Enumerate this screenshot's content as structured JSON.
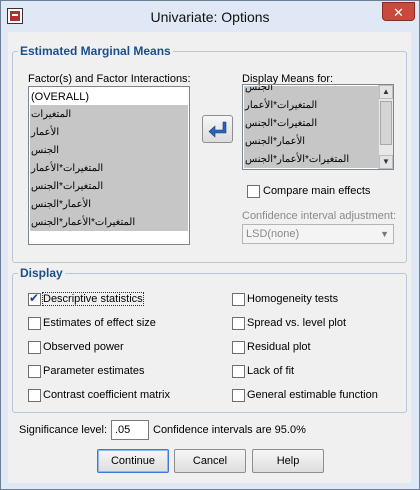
{
  "window": {
    "title": "Univariate: Options",
    "close_label": "✕"
  },
  "emm": {
    "legend": "Estimated Marginal Means",
    "factors_label": "Factor(s) and Factor Interactions:",
    "factors_items": [
      "(OVERALL)",
      "المتغيرات",
      "الأعمار",
      "الجنس",
      "المتغيرات*الأعمار",
      "المتغيرات*الجنس",
      "الأعمار*الجنس",
      "المتغيرات*الأعمار*الجنس"
    ],
    "display_label": "Display Means for:",
    "display_items": [
      "الجنس",
      "المتغيرات*الأعمار",
      "المتغيرات*الجنس",
      "الأعمار*الجنس",
      "المتغيرات*الأعمار*الجنس"
    ],
    "compare_label": "Compare main effects",
    "ci_adjust_label": "Confidence interval adjustment:",
    "ci_adjust_value": "LSD(none)"
  },
  "display": {
    "legend": "Display",
    "options": [
      {
        "label": "Descriptive statistics",
        "checked": true
      },
      {
        "label": "Homogeneity tests",
        "checked": false
      },
      {
        "label": "Estimates of effect size",
        "checked": false
      },
      {
        "label": "Spread vs. level plot",
        "checked": false
      },
      {
        "label": "Observed power",
        "checked": false
      },
      {
        "label": "Residual plot",
        "checked": false
      },
      {
        "label": "Parameter estimates",
        "checked": false
      },
      {
        "label": "Lack of fit",
        "checked": false
      },
      {
        "label": "Contrast coefficient matrix",
        "checked": false
      },
      {
        "label": "General estimable function",
        "checked": false
      }
    ]
  },
  "significance": {
    "label": "Significance level:",
    "value": ".05",
    "ci_text": "Confidence intervals are 95.0%"
  },
  "buttons": {
    "continue": "Continue",
    "cancel": "Cancel",
    "help": "Help"
  },
  "colors": {
    "legend": "#1b4e8c",
    "titlebar": "#dfe8f4",
    "close": "#c94a3c",
    "check": "#1c3f8a"
  },
  "icons": {
    "move": "arrow-left-icon",
    "app": "spss-app-icon"
  }
}
